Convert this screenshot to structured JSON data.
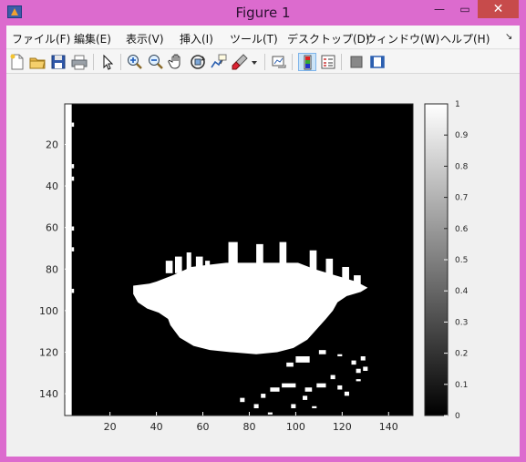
{
  "window": {
    "title": "Figure 1",
    "minimize_glyph": "—",
    "maximize_glyph": "▭",
    "close_glyph": "✕"
  },
  "menu": {
    "items": [
      {
        "label": "ファイル(F)"
      },
      {
        "label": "編集(E)"
      },
      {
        "label": "表示(V)"
      },
      {
        "label": "挿入(I)"
      },
      {
        "label": "ツール(T)"
      },
      {
        "label": "デスクトップ(D)"
      },
      {
        "label": "ウィンドウ(W)"
      },
      {
        "label": "ヘルプ(H)"
      }
    ],
    "overflow_glyph": "↘"
  },
  "toolbar": {
    "icons": [
      "new-figure-icon",
      "open-file-icon",
      "save-icon",
      "print-icon",
      "pointer-icon",
      "zoom-in-icon",
      "zoom-out-icon",
      "pan-hand-icon",
      "rotate-3d-icon",
      "data-cursor-icon",
      "brush-icon",
      "brush-dropdown-icon",
      "link-plot-icon",
      "colorbar-icon",
      "legend-icon",
      "hide-plot-tools-icon",
      "show-plot-tools-icon"
    ],
    "active": "colorbar-icon"
  },
  "chart_data": {
    "type": "heatmap",
    "colormap": "gray",
    "x_ticks": [
      20,
      40,
      60,
      80,
      100,
      120,
      140
    ],
    "y_ticks": [
      20,
      40,
      60,
      80,
      100,
      120,
      140
    ],
    "xlim": [
      0.5,
      150.5
    ],
    "ylim": [
      0.5,
      150.5
    ],
    "y_direction": "reverse",
    "colorbar": {
      "ticks": [
        "0",
        "0.1",
        "0.2",
        "0.3",
        "0.4",
        "0.5",
        "0.6",
        "0.7",
        "0.8",
        "0.9",
        "1"
      ],
      "range": [
        0,
        1
      ]
    },
    "values": "binary image: black (0) background, white (1) splash-shaped blob centered near x=80, y=100 with spikes upward; white vertical strip along x=1..4"
  }
}
